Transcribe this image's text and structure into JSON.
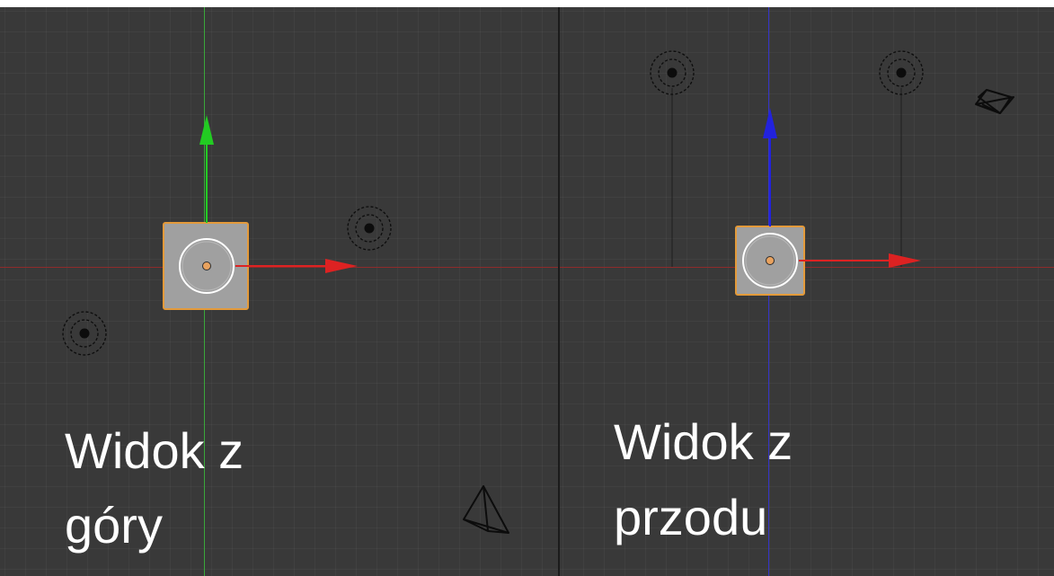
{
  "viewports": [
    {
      "label_line1": "Widok z",
      "label_line2": "góry"
    },
    {
      "label_line1": "Widok z",
      "label_line2": "przodu"
    }
  ],
  "colors": {
    "background": "#393939",
    "grid_line": "#444444",
    "x_axis": "#cc1e1e",
    "y_axis": "#22cc22",
    "z_axis": "#2222dd",
    "selected_outline": "#e39a3a",
    "selected_face": "#a0a0a0",
    "origin_dot": "#e8a25f",
    "label_text": "#ffffff"
  },
  "icons": {
    "light": "light-lamp-icon",
    "camera": "camera-icon",
    "object_origin": "object-origin-icon",
    "transform_arrow": "transform-arrow-icon"
  }
}
